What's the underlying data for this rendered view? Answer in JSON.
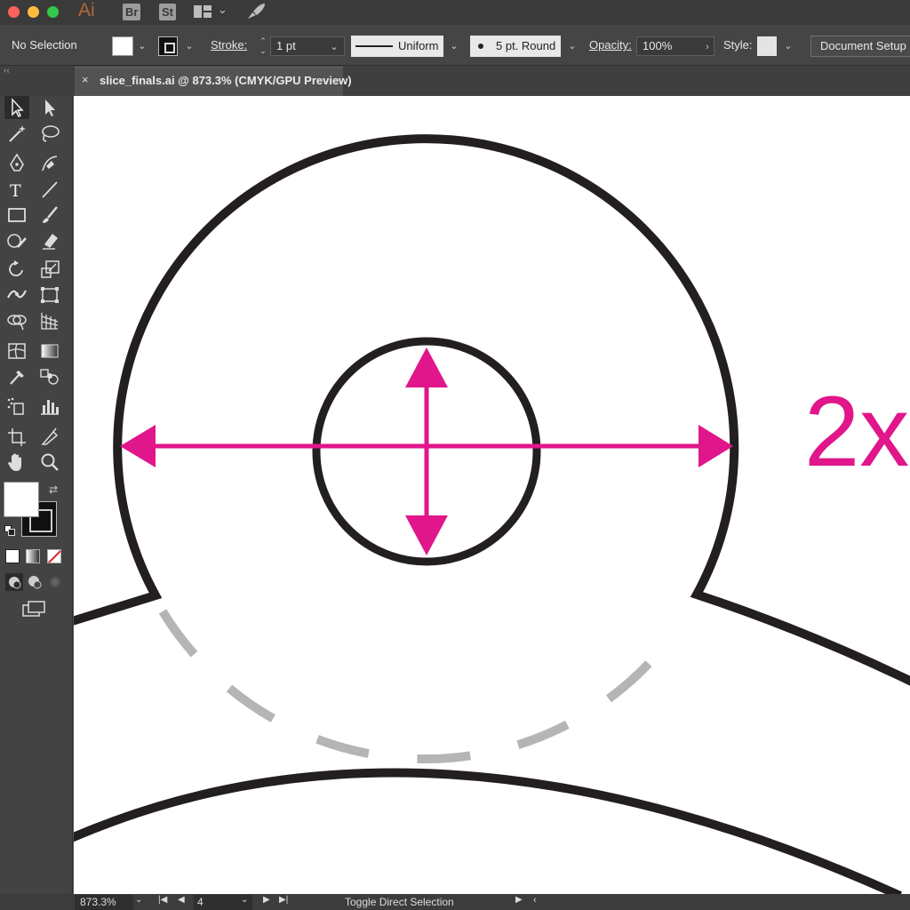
{
  "titlebar": {
    "app_logo": "Ai",
    "bridge_label": "Br",
    "stock_label": "St"
  },
  "controlbar": {
    "selection_label": "No Selection",
    "stroke_label": "Stroke:",
    "stroke_weight": "1 pt",
    "profile_label": "Uniform",
    "brush_label": "5 pt. Round",
    "opacity_label": "Opacity:",
    "opacity_value": "100%",
    "style_label": "Style:",
    "document_setup": "Document Setup"
  },
  "tabbar": {
    "collapse": "‹‹",
    "close": "×",
    "document_title": "slice_finals.ai @ 873.3% (CMYK/GPU Preview)"
  },
  "canvas": {
    "annotation": "2x",
    "accent_color": "#e0168a",
    "stroke_color": "#231f20",
    "dash_color": "#b5b5b5"
  },
  "statusbar": {
    "zoom": "873.3%",
    "artboard": "4",
    "status_text": "Toggle Direct Selection"
  }
}
